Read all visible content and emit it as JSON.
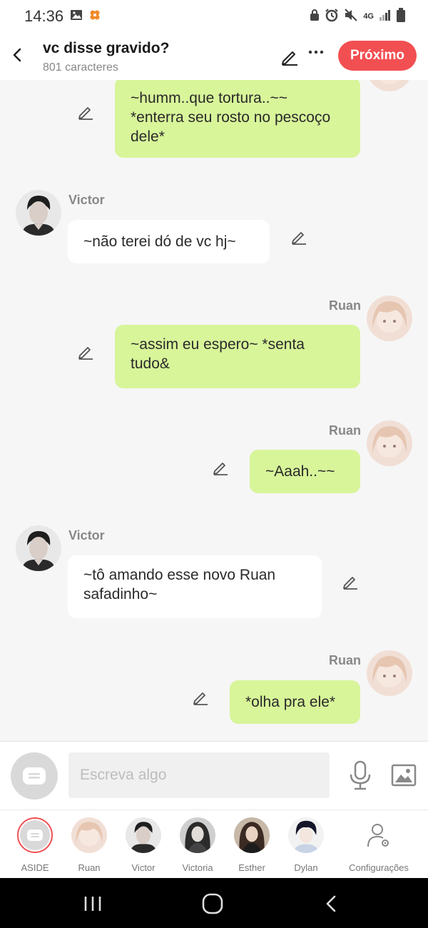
{
  "status_bar": {
    "time": "14:36",
    "network": "4G"
  },
  "header": {
    "title": "vc disse gravido?",
    "subtitle": "801 caracteres",
    "next_label": "Próximo"
  },
  "messages": [
    {
      "sender": "Ruan",
      "side": "right",
      "text": "~humm..que tortura..~~ *enterra seu rosto no pescoço dele*"
    },
    {
      "sender": "Victor",
      "side": "left",
      "text": "~não terei dó de vc hj~"
    },
    {
      "sender": "Ruan",
      "side": "right",
      "text": "~assim eu espero~ *senta tudo&"
    },
    {
      "sender": "Ruan",
      "side": "right",
      "text": "~Aaah..~~"
    },
    {
      "sender": "Victor",
      "side": "left",
      "text": "~tô amando esse novo Ruan safadinho~"
    },
    {
      "sender": "Ruan",
      "side": "right",
      "text": "*olha pra ele*"
    }
  ],
  "composer": {
    "placeholder": "Escreva algo"
  },
  "characters": [
    {
      "label": "ASIDE"
    },
    {
      "label": "Ruan"
    },
    {
      "label": "Victor"
    },
    {
      "label": "Victoria"
    },
    {
      "label": "Esther"
    },
    {
      "label": "Dylan"
    },
    {
      "label": "Configurações"
    }
  ],
  "colors": {
    "accent": "#f24f52",
    "my_bubble": "#d8f59a",
    "their_bubble": "#ffffff",
    "background": "#f6f6f6"
  }
}
